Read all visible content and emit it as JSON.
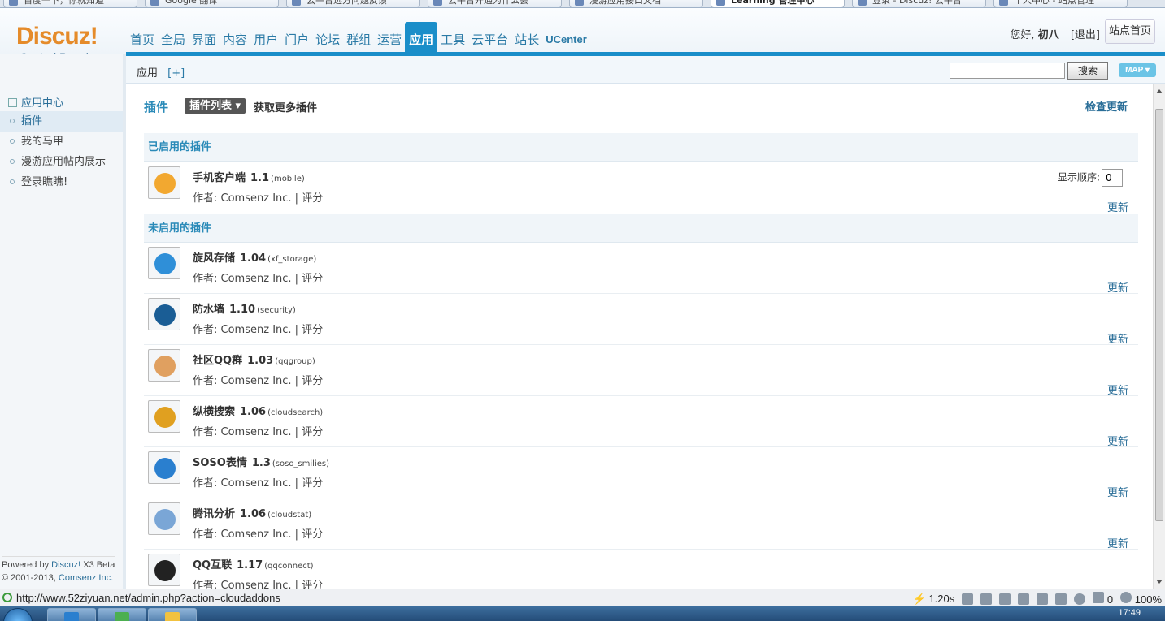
{
  "browser": {
    "tabs": [
      {
        "label": "百度一下，你就知道",
        "active": false
      },
      {
        "label": "Google 翻译",
        "active": false
      },
      {
        "label": "云平台远方问题反馈",
        "active": false
      },
      {
        "label": "云平台开通为什么会",
        "active": false
      },
      {
        "label": "漫游应用接口文档",
        "active": false
      },
      {
        "label": "Learning 管理中心",
        "active": true
      },
      {
        "label": "登录 - Discuz! 云平台",
        "active": false
      },
      {
        "label": "个人中心 - 站点管理",
        "active": false
      }
    ],
    "status_url": "http://www.52ziyuan.net/admin.php?action=cloudaddons",
    "load_time": "1.20s",
    "counter": "0",
    "zoom": "100%"
  },
  "header": {
    "logo_main": "Discuz!",
    "logo_sub": "Control Panel",
    "nav": [
      "首页",
      "全局",
      "界面",
      "内容",
      "用户",
      "门户",
      "论坛",
      "群组",
      "运营",
      "应用",
      "工具",
      "云平台",
      "站长",
      "UCenter"
    ],
    "active_nav": "应用",
    "greeting": "您好,",
    "username": "初八",
    "logout": "[退出]",
    "site_home": "站点首页"
  },
  "subbar": {
    "crumb": "应用",
    "add": "[+]",
    "search_button": "搜索",
    "map_button": "MAP"
  },
  "sidebar": {
    "heading": "应用中心",
    "items": [
      "插件",
      "我的马甲",
      "漫游应用帖内展示",
      "登录瞧瞧!"
    ],
    "active_index": 0,
    "footer_powered": "Powered by",
    "footer_product": "Discuz!",
    "footer_version": "X3 Beta",
    "footer_copy": "© 2001-2013,",
    "footer_company": "Comsenz Inc."
  },
  "main": {
    "title": "插件",
    "tab_label": "插件列表",
    "more_plugins": "获取更多插件",
    "check_update": "检查更新",
    "enabled_heading": "已启用的插件",
    "disabled_heading": "未启用的插件",
    "order_label": "显示顺序:",
    "order_value": "0",
    "author_prefix": "作者:",
    "author": "Comsenz Inc.",
    "rate": "评分",
    "update": "更新",
    "enabled": [
      {
        "name": "手机客户端",
        "version": "1.1",
        "id": "(mobile)",
        "icon": "mobile-client-icon",
        "color": "#f2a830"
      }
    ],
    "disabled": [
      {
        "name": "旋风存储",
        "version": "1.04",
        "id": "(xf_storage)",
        "icon": "storage-globe-icon",
        "color": "#2f8fd8"
      },
      {
        "name": "防水墙",
        "version": "1.10",
        "id": "(security)",
        "icon": "security-shield-icon",
        "color": "#1a5d95"
      },
      {
        "name": "社区QQ群",
        "version": "1.03",
        "id": "(qqgroup)",
        "icon": "qq-group-icon",
        "color": "#e0a060"
      },
      {
        "name": "纵横搜索",
        "version": "1.06",
        "id": "(cloudsearch)",
        "icon": "cloud-search-icon",
        "color": "#e0a020"
      },
      {
        "name": "SOSO表情",
        "version": "1.3",
        "id": "(soso_smilies)",
        "icon": "soso-smilies-icon",
        "color": "#2a7fcf"
      },
      {
        "name": "腾讯分析",
        "version": "1.06",
        "id": "(cloudstat)",
        "icon": "cloud-stat-icon",
        "color": "#7aa6d6"
      },
      {
        "name": "QQ互联",
        "version": "1.17",
        "id": "(qqconnect)",
        "icon": "qq-connect-icon",
        "color": "#222222"
      }
    ]
  },
  "taskbar": {
    "clock": "17:49"
  }
}
